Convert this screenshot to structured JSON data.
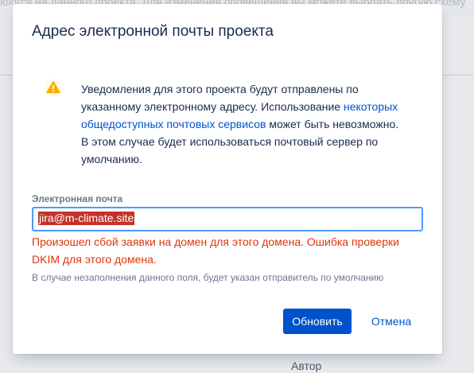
{
  "background": {
    "top_text": "ююгся на данного проекта. Для изменения оповещения вы можете выбрать другую схему",
    "author_label": "Автор"
  },
  "dialog": {
    "title": "Адрес электронной почты проекта",
    "warning": {
      "icon": "warning-icon",
      "text_before_link": "Уведомления для этого проекта будут отправлены по указанному электронному адресу. Использование ",
      "link_text": "некоторых общедоступных почтовых сервисов",
      "text_after_link": " может быть невозможно. В этом случае будет использоваться почтовый сервер по умолчанию."
    },
    "email": {
      "label": "Электронная почта",
      "value": "jira@m-climate.site"
    },
    "error": "Произошел сбой заявки на домен для этого домена. Ошибка проверки DKIM для этого домена.",
    "help": "В случае незаполнения данного поля, будет указан отправитель по умолчанию",
    "buttons": {
      "update": "Обновить",
      "cancel": "Отмена"
    }
  },
  "colors": {
    "primary": "#0052cc",
    "error": "#de350b",
    "warning": "#ffab00",
    "focus_border": "#4c9aff",
    "selection": "#c4322a"
  }
}
